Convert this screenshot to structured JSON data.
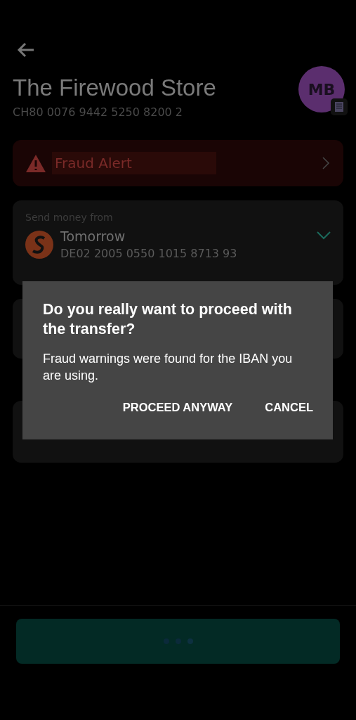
{
  "header": {
    "title": "The Firewood Store",
    "iban": "CH80 0076 9442 5250 8200 2",
    "avatar": "MB"
  },
  "fraud_alert": {
    "label": "Fraud Alert"
  },
  "send_from": {
    "label": "Send money from",
    "account_name": "Tomorrow",
    "account_iban": "DE02 2005 0550 1015 8713 93",
    "expanded": false
  },
  "dialog": {
    "title": "Do you really want to proceed with the transfer?",
    "message": "Fraud warnings were found for the IBAN you are using.",
    "buttons": [
      "PROCEED ANYWAY",
      "CANCEL"
    ]
  },
  "submit": {
    "loading": true
  }
}
